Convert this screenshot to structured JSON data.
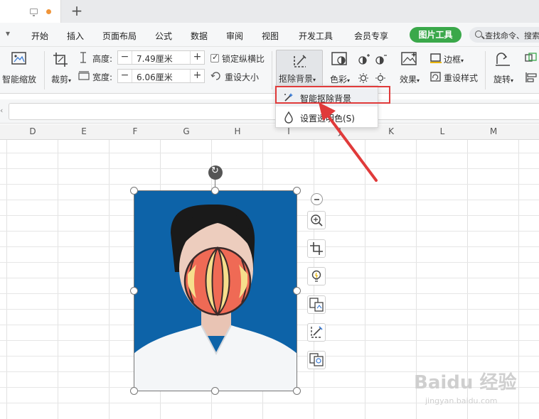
{
  "menubar": {
    "items": [
      "开始",
      "插入",
      "页面布局",
      "公式",
      "数据",
      "审阅",
      "视图",
      "开发工具",
      "会员专享"
    ],
    "picture_tool": "图片工具",
    "search_placeholder": "查找命令、搜索"
  },
  "ribbon": {
    "smart_zoom": "智能缩放",
    "crop": "裁剪",
    "height_label": "高度:",
    "height_value": "7.49厘米",
    "width_label": "宽度:",
    "width_value": "6.06厘米",
    "lock_ratio": "锁定纵横比",
    "reset_size": "重设大小",
    "remove_bg": "抠除背景",
    "color": "色彩",
    "effects": "效果",
    "border": "边框",
    "reset_style": "重设样式",
    "rotate": "旋转"
  },
  "dropdown": {
    "items": [
      "智能抠除背景",
      "设置透明色(S)"
    ]
  },
  "columns": [
    "D",
    "E",
    "F",
    "G",
    "H",
    "I",
    "J",
    "K",
    "L",
    "M"
  ],
  "colors": {
    "accent_green": "#3aa84a",
    "highlight_red": "#e03a3a",
    "photo_bg": "#0d63a8"
  },
  "watermark": {
    "brand": "Baidu 经验",
    "url": "jingyan.baidu.com"
  }
}
